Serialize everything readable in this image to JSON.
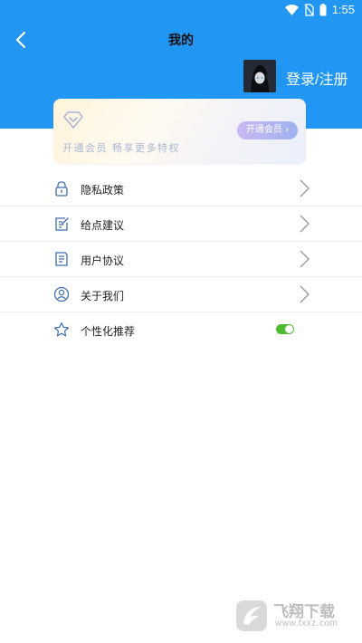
{
  "status_bar": {
    "time": "1:55"
  },
  "header": {
    "title": "我的",
    "login_label": "登录/注册"
  },
  "vip": {
    "text": "开通会员  畅享更多特权",
    "button_label": "开通会员"
  },
  "menu": {
    "items": [
      {
        "label": "隐私政策"
      },
      {
        "label": "给点建议"
      },
      {
        "label": "用户协议"
      },
      {
        "label": "关于我们"
      },
      {
        "label": "个性化推荐"
      }
    ]
  },
  "toggle": {
    "personalized": "on"
  },
  "colors": {
    "primary": "#2196f3",
    "toggle_on": "#4cbb2f",
    "icon": "#3f6fb0"
  },
  "watermark": {
    "title": "飞翔下载",
    "url": "www.fxxz.com"
  }
}
